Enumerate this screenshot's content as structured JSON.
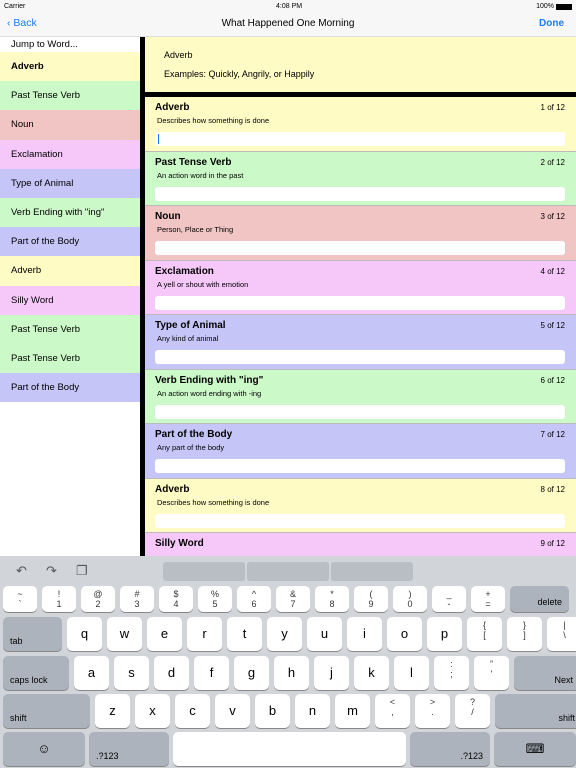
{
  "status": {
    "carrier": "Carrier",
    "time": "4:08 PM",
    "battery": "100%"
  },
  "nav": {
    "back": "Back",
    "title": "What Happened One Morning",
    "done": "Done"
  },
  "sidebar": {
    "jump": "Jump to Word...",
    "items": [
      {
        "label": "Adverb",
        "color": "#fffbc4",
        "selected": true
      },
      {
        "label": "Past Tense Verb",
        "color": "#ccf9c8"
      },
      {
        "label": "Noun",
        "color": "#f2c5c5"
      },
      {
        "label": "Exclamation",
        "color": "#f5c8f9"
      },
      {
        "label": "Type of Animal",
        "color": "#c5c6f7"
      },
      {
        "label": "Verb Ending with \"ing\"",
        "color": "#ccf9c8"
      },
      {
        "label": "Part of the Body",
        "color": "#c5c6f7"
      },
      {
        "label": "Adverb",
        "color": "#fffbc4"
      },
      {
        "label": "Silly Word",
        "color": "#f5c8f9"
      },
      {
        "label": "Past Tense Verb",
        "color": "#ccf9c8"
      },
      {
        "label": "Past Tense Verb",
        "color": "#ccf9c8"
      },
      {
        "label": "Part of the Body",
        "color": "#c5c6f7"
      }
    ]
  },
  "header": {
    "word": "Adverb",
    "examples": "Examples: Quickly, Angrily, or Happily"
  },
  "cards": [
    {
      "title": "Adverb",
      "num": "1 of 12",
      "desc": "Describes how something is done",
      "color": "#fffbc4",
      "value": ""
    },
    {
      "title": "Past Tense Verb",
      "num": "2 of 12",
      "desc": "An action word in the past",
      "color": "#ccf9c8",
      "value": ""
    },
    {
      "title": "Noun",
      "num": "3 of 12",
      "desc": "Person, Place or Thing",
      "color": "#f2c5c5",
      "value": ""
    },
    {
      "title": "Exclamation",
      "num": "4 of 12",
      "desc": "A yell or shout with emotion",
      "color": "#f5c8f9",
      "value": ""
    },
    {
      "title": "Type of Animal",
      "num": "5 of 12",
      "desc": "Any kind of animal",
      "color": "#c5c6f7",
      "value": ""
    },
    {
      "title": "Verb Ending with \"ing\"",
      "num": "6 of 12",
      "desc": "An action word ending with -ing",
      "color": "#ccf9c8",
      "value": ""
    },
    {
      "title": "Part of the Body",
      "num": "7 of 12",
      "desc": "Any part of the body",
      "color": "#c5c6f7",
      "value": ""
    },
    {
      "title": "Adverb",
      "num": "8 of 12",
      "desc": "Describes how something is done",
      "color": "#fffbc4",
      "value": ""
    },
    {
      "title": "Silly Word",
      "num": "9 of 12",
      "desc": "",
      "color": "#f5c8f9",
      "value": ""
    }
  ],
  "keyboard": {
    "rows": [
      [
        [
          "~",
          "`"
        ],
        [
          "!",
          "1"
        ],
        [
          "@",
          "2"
        ],
        [
          "#",
          "3"
        ],
        [
          "$",
          "4"
        ],
        [
          "%",
          "5"
        ],
        [
          "^",
          "6"
        ],
        [
          "&",
          "7"
        ],
        [
          "*",
          "8"
        ],
        [
          "(",
          "9"
        ],
        [
          ")",
          "0"
        ],
        [
          "_",
          "-"
        ],
        [
          "+",
          "="
        ],
        [
          "delete"
        ]
      ],
      [
        [
          "tab"
        ],
        [
          "q"
        ],
        [
          "w"
        ],
        [
          "e"
        ],
        [
          "r"
        ],
        [
          "t"
        ],
        [
          "y"
        ],
        [
          "u"
        ],
        [
          "i"
        ],
        [
          "o"
        ],
        [
          "p"
        ],
        [
          "{",
          "["
        ],
        [
          "}",
          "]"
        ],
        [
          "|",
          "\\"
        ]
      ],
      [
        [
          "caps lock"
        ],
        [
          "a"
        ],
        [
          "s"
        ],
        [
          "d"
        ],
        [
          "f"
        ],
        [
          "g"
        ],
        [
          "h"
        ],
        [
          "j"
        ],
        [
          "k"
        ],
        [
          "l"
        ],
        [
          ":",
          ";"
        ],
        [
          "”",
          "'"
        ],
        [
          "Next"
        ]
      ],
      [
        [
          "shift"
        ],
        [
          "z"
        ],
        [
          "x"
        ],
        [
          "c"
        ],
        [
          "v"
        ],
        [
          "b"
        ],
        [
          "n"
        ],
        [
          "m"
        ],
        [
          "<",
          ","
        ],
        [
          ">",
          "."
        ],
        [
          "?",
          "/"
        ],
        [
          "shift"
        ]
      ],
      [
        [
          "☺"
        ],
        [
          ".?123"
        ],
        [
          " "
        ],
        [
          ".?123"
        ],
        [
          "⌨"
        ]
      ]
    ]
  }
}
